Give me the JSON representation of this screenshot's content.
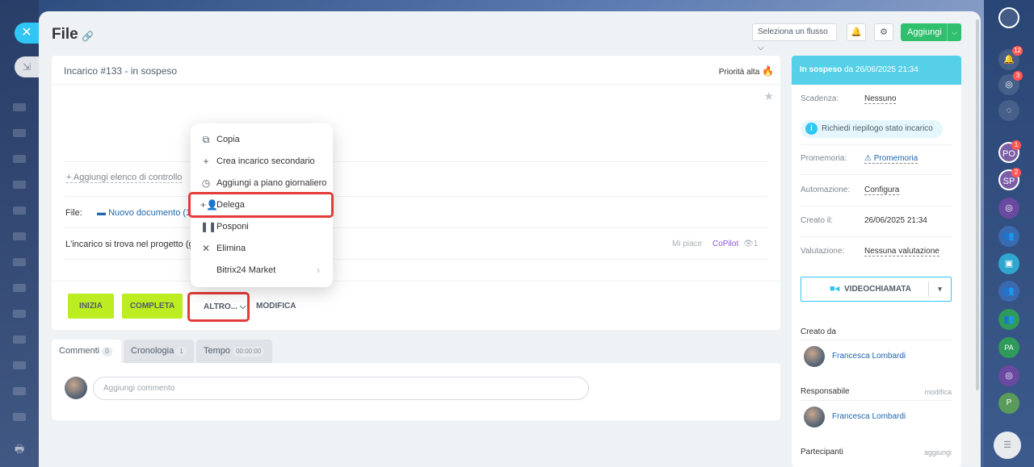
{
  "window": {
    "title": "File"
  },
  "header": {
    "flow_select": "Seleziona un flusso",
    "add_label": "Aggiungi"
  },
  "task": {
    "title": "Incarico #133 - in sospeso",
    "priority": "Priorità alta",
    "checklist_link": "+ Aggiungi elenco di controllo",
    "file_label": "File:",
    "file_link": "Nuovo documento (1)...",
    "project_text": "L'incarico si trova nel progetto (g",
    "likes": "Mi piace",
    "copilot": "CoPilot",
    "views": "1"
  },
  "actions": {
    "start": "INIZIA",
    "complete": "COMPLETA",
    "more": "ALTRO...",
    "edit": "MODIFICA"
  },
  "menu": {
    "items": [
      {
        "label": "Copia",
        "icon": "copy-icon"
      },
      {
        "label": "Crea incarico secondario",
        "icon": "plus-icon"
      },
      {
        "label": "Aggiungi a piano giornaliero",
        "icon": "clock-icon"
      },
      {
        "label": "Delega",
        "icon": "delegate-icon"
      },
      {
        "label": "Posponi",
        "icon": "pause-icon"
      },
      {
        "label": "Elimina",
        "icon": "delete-icon"
      },
      {
        "label": "Bitrix24 Market",
        "icon": ""
      }
    ]
  },
  "tabs": [
    {
      "label": "Commenti",
      "count": "0"
    },
    {
      "label": "Cronologia",
      "count": "1"
    },
    {
      "label": "Tempo",
      "count": "00:00:00"
    }
  ],
  "comment": {
    "placeholder": "Aggiungi commento"
  },
  "side": {
    "status_bold": "In sospeso",
    "status_rest": " da 26/06/2025 21:34",
    "deadline_label": "Scadenza:",
    "deadline_value": "Nessuno",
    "summary": "Richiedi riepilogo stato incarico",
    "reminder_label": "Promemoria:",
    "reminder_value": "Promemoria",
    "automation_label": "Automazione:",
    "automation_value": "Configura",
    "created_label": "Creato il:",
    "created_value": "26/06/2025 21:34",
    "rating_label": "Valutazione:",
    "rating_value": "Nessuna valutazione",
    "video_call": "VIDEOCHIAMATA",
    "created_by_label": "Creato da",
    "created_by_name": "Francesca Lombardi",
    "responsible_label": "Responsabile",
    "responsible_action": "modifica",
    "responsible_name": "Francesca Lombardi",
    "participants_label": "Partecipanti",
    "participants_action": "aggiungi"
  },
  "right_bar": {
    "notifications_badge": "12",
    "activity_badge": "3",
    "avatar1": "PO",
    "avatar1_badge": "1",
    "avatar2": "SP",
    "avatar2_badge": "2",
    "avatar3": "PA",
    "avatar4": "P"
  }
}
